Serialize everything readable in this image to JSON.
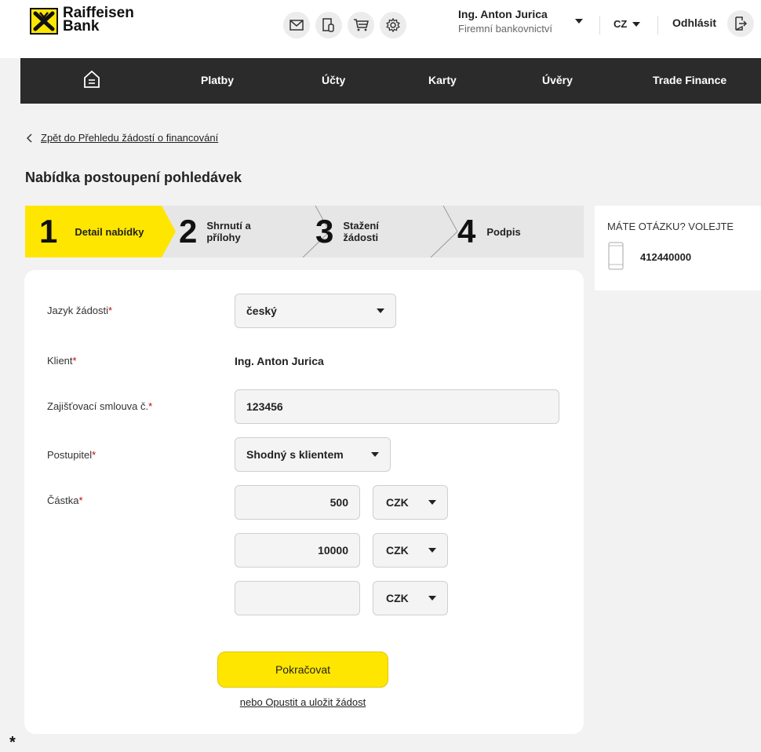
{
  "brand": {
    "line1": "Raiffeisen",
    "line2": "Bank",
    "accent": "#fee600"
  },
  "header": {
    "icons": [
      "mail-icon",
      "document-icon",
      "cart-icon",
      "settings-icon"
    ],
    "user_name": "Ing. Anton Jurica",
    "user_role": "Firemní bankovnictví",
    "language": "CZ",
    "logout": "Odhlásit"
  },
  "nav": {
    "items": [
      "Platby",
      "Účty",
      "Karty",
      "Úvěry",
      "Trade Finance"
    ]
  },
  "back_link": "Zpět do Přehledu žádostí o financování",
  "page_title": "Nabídka postoupení pohledávek",
  "steps": [
    {
      "num": "1",
      "label": "Detail nabídky"
    },
    {
      "num": "2",
      "label": "Shrnutí a přílohy"
    },
    {
      "num": "3",
      "label": "Stažení žádosti"
    },
    {
      "num": "4",
      "label": "Podpis"
    }
  ],
  "help": {
    "title": "MÁTE OTÁZKU? VOLEJTE",
    "phone": "412440000"
  },
  "form": {
    "language_label": "Jazyk žádosti",
    "language_value": "český",
    "client_label": "Klient",
    "client_value": "Ing. Anton Jurica",
    "contract_label": "Zajišťovací smlouva č.",
    "contract_value": "123456",
    "assignor_label": "Postupitel",
    "assignor_value": "Shodný s klientem",
    "amount_label": "Částka",
    "amounts": [
      {
        "value": "500",
        "currency": "CZK"
      },
      {
        "value": "10000",
        "currency": "CZK"
      },
      {
        "value": "",
        "currency": "CZK"
      }
    ],
    "required_mark": "*",
    "continue_button": "Pokračovat",
    "save_link": "nebo Opustit a uložit žádost"
  },
  "footer_mark": "*"
}
